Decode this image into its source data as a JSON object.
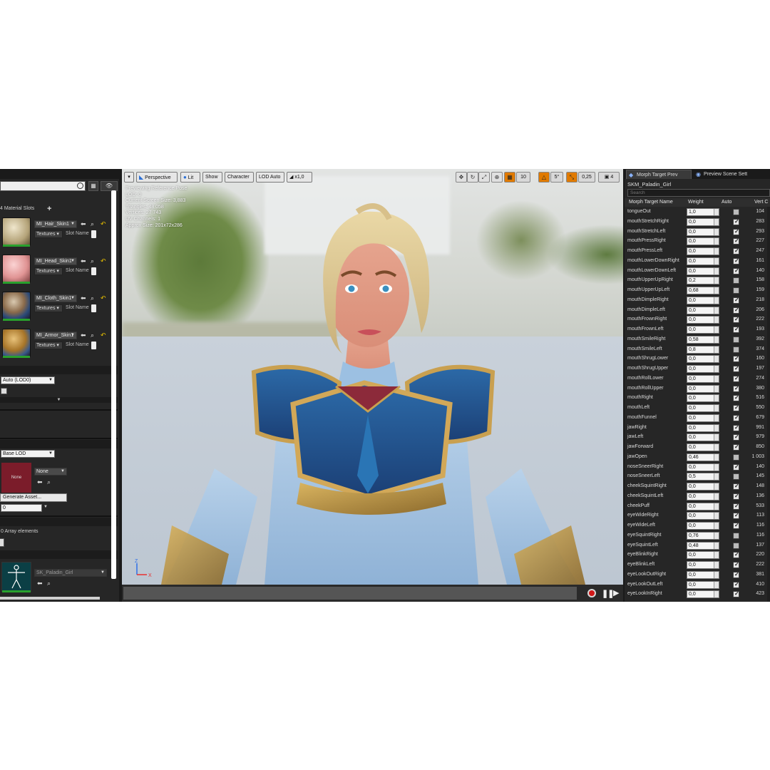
{
  "left_panel": {
    "material_slots_label": "4 Material Slots",
    "materials": [
      {
        "name": "MI_Hair_Skin1",
        "textures": "Textures",
        "slot_name": "Slot Name",
        "color": "#cdbf9c"
      },
      {
        "name": "MI_Head_Skin1",
        "textures": "Textures",
        "slot_name": "Slot Name",
        "color": "#e8a0a0"
      },
      {
        "name": "MI_Cloth_Skin1",
        "textures": "Textures",
        "slot_name": "Slot Name",
        "color": "#6a5a4a"
      },
      {
        "name": "MI_Armor_Skin1",
        "textures": "Textures",
        "slot_name": "Slot Name",
        "color": "#8a6a3a"
      }
    ],
    "lod_combo": "Auto (LOD0)",
    "base_lod_combo": "Base LOD",
    "none_thumb": "None",
    "none_combo": "None",
    "generate_asset": "Generate Asset...",
    "number_field": "0",
    "array_elements": "0 Array elements",
    "skeleton": "SK_Paladin_Girl"
  },
  "viewport": {
    "toolbar": {
      "perspective": "Perspective",
      "lit": "Lit",
      "show": "Show",
      "character": "Character",
      "lod_auto": "LOD Auto",
      "speed": "x1,0",
      "grid_snap": "10",
      "rot_snap": "5°",
      "scale_snap": "0,25",
      "cam_speed": "4"
    },
    "info_lines": [
      "Previewing Reference Pose",
      "LOD: 0",
      "Current Screen Size: 3,883",
      "Triangles: 48 058",
      "Vertices: 27 743",
      "UV Channels: 1",
      "Approx Size: 201x72x286"
    ],
    "axis": {
      "z": "Z",
      "x": "X"
    }
  },
  "right_panel": {
    "tabs": [
      {
        "label": "Morph Target Prev",
        "icon": "morph-icon"
      },
      {
        "label": "Preview Scene Sett",
        "icon": "scene-icon"
      }
    ],
    "mesh_name": "SKM_Paladin_Girl",
    "search_placeholder": "Search",
    "headers": {
      "name": "Morph Target Name",
      "weight": "Weight",
      "auto": "Auto",
      "vert": "Vert C"
    },
    "rows": [
      {
        "name": "tongueOut",
        "weight": "1,0",
        "auto": false,
        "vert": "104"
      },
      {
        "name": "mouthStretchRight",
        "weight": "0,0",
        "auto": true,
        "vert": "283"
      },
      {
        "name": "mouthStretchLeft",
        "weight": "0,0",
        "auto": true,
        "vert": "293"
      },
      {
        "name": "mouthPressRight",
        "weight": "0,0",
        "auto": true,
        "vert": "227"
      },
      {
        "name": "mouthPressLeft",
        "weight": "0,0",
        "auto": true,
        "vert": "247"
      },
      {
        "name": "mouthLowerDownRight",
        "weight": "0,0",
        "auto": true,
        "vert": "161"
      },
      {
        "name": "mouthLowerDownLeft",
        "weight": "0,0",
        "auto": true,
        "vert": "140"
      },
      {
        "name": "mouthUpperUpRight",
        "weight": "0,2",
        "auto": false,
        "vert": "158"
      },
      {
        "name": "mouthUpperUpLeft",
        "weight": "0,68",
        "auto": false,
        "vert": "159"
      },
      {
        "name": "mouthDimpleRight",
        "weight": "0,0",
        "auto": true,
        "vert": "218"
      },
      {
        "name": "mouthDimpleLeft",
        "weight": "0,0",
        "auto": true,
        "vert": "206"
      },
      {
        "name": "mouthFrownRight",
        "weight": "0,0",
        "auto": true,
        "vert": "222"
      },
      {
        "name": "mouthFrownLeft",
        "weight": "0,0",
        "auto": true,
        "vert": "193"
      },
      {
        "name": "mouthSmileRight",
        "weight": "0,58",
        "auto": false,
        "vert": "392"
      },
      {
        "name": "mouthSmileLeft",
        "weight": "0,8",
        "auto": false,
        "vert": "374"
      },
      {
        "name": "mouthShrugLower",
        "weight": "0,0",
        "auto": true,
        "vert": "160"
      },
      {
        "name": "mouthShrugUpper",
        "weight": "0,0",
        "auto": true,
        "vert": "197"
      },
      {
        "name": "mouthRollLower",
        "weight": "0,0",
        "auto": true,
        "vert": "274"
      },
      {
        "name": "mouthRollUpper",
        "weight": "0,0",
        "auto": true,
        "vert": "380"
      },
      {
        "name": "mouthRight",
        "weight": "0,0",
        "auto": true,
        "vert": "516"
      },
      {
        "name": "mouthLeft",
        "weight": "0,0",
        "auto": true,
        "vert": "550"
      },
      {
        "name": "mouthFunnel",
        "weight": "0,0",
        "auto": true,
        "vert": "679"
      },
      {
        "name": "jawRight",
        "weight": "0,0",
        "auto": true,
        "vert": "991"
      },
      {
        "name": "jawLeft",
        "weight": "0,0",
        "auto": true,
        "vert": "979"
      },
      {
        "name": "jawForward",
        "weight": "0,0",
        "auto": true,
        "vert": "850"
      },
      {
        "name": "jawOpen",
        "weight": "0,46",
        "auto": false,
        "vert": "1 003"
      },
      {
        "name": "noseSneerRight",
        "weight": "0,0",
        "auto": true,
        "vert": "140"
      },
      {
        "name": "noseSneerLeft",
        "weight": "0,5",
        "auto": false,
        "vert": "145"
      },
      {
        "name": "cheekSquintRight",
        "weight": "0,0",
        "auto": true,
        "vert": "148"
      },
      {
        "name": "cheekSquintLeft",
        "weight": "0,0",
        "auto": true,
        "vert": "136"
      },
      {
        "name": "cheekPuff",
        "weight": "0,0",
        "auto": true,
        "vert": "533"
      },
      {
        "name": "eyeWideRight",
        "weight": "0,0",
        "auto": true,
        "vert": "113"
      },
      {
        "name": "eyeWideLeft",
        "weight": "0,0",
        "auto": true,
        "vert": "116"
      },
      {
        "name": "eyeSquintRight",
        "weight": "0,76",
        "auto": false,
        "vert": "116"
      },
      {
        "name": "eyeSquintLeft",
        "weight": "0,48",
        "auto": false,
        "vert": "137"
      },
      {
        "name": "eyeBlinkRight",
        "weight": "0,0",
        "auto": true,
        "vert": "220"
      },
      {
        "name": "eyeBlinkLeft",
        "weight": "0,0",
        "auto": true,
        "vert": "222"
      },
      {
        "name": "eyeLookOutRight",
        "weight": "0,0",
        "auto": true,
        "vert": "381"
      },
      {
        "name": "eyeLookOutLeft",
        "weight": "0,0",
        "auto": true,
        "vert": "410"
      },
      {
        "name": "eyeLookInRight",
        "weight": "0,0",
        "auto": true,
        "vert": "423"
      }
    ]
  }
}
